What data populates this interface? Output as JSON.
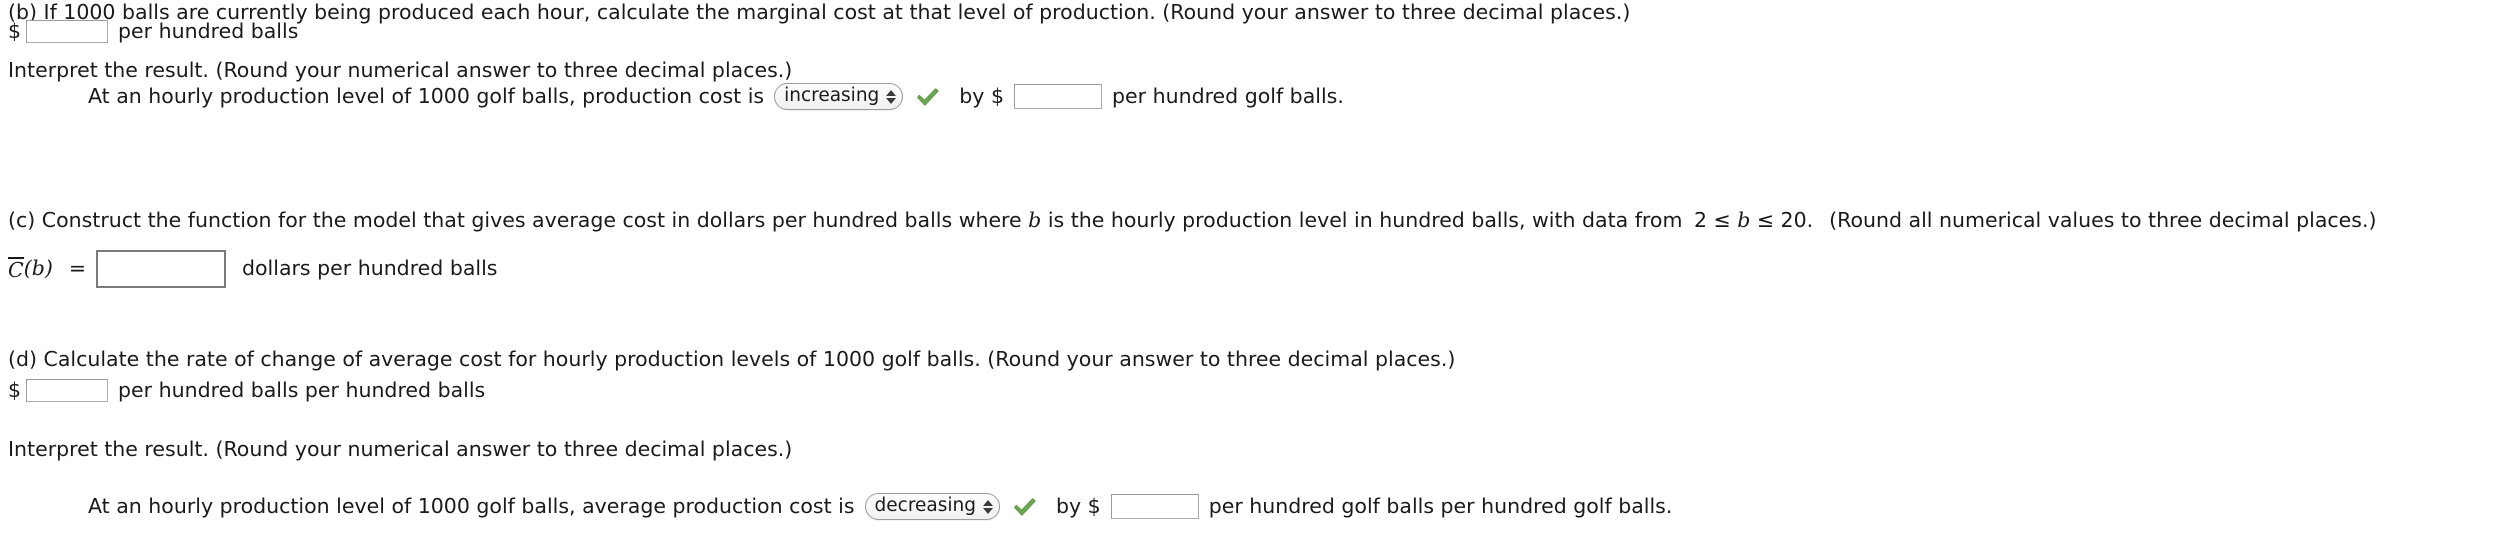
{
  "colors": {
    "text": "#1a1a1a",
    "check_green": "#6aa84f",
    "input_border": "#a9a9a9",
    "pill_border": "#9b9b9b",
    "background": "#ffffff"
  },
  "part_b": {
    "prompt": "(b) If 1000 balls are currently being produced each hour, calculate the marginal cost at that level of production. (Round your answer to three decimal places.)",
    "dollar_sign": "$",
    "answer_value": "",
    "answer_placeholder": "",
    "units": "per hundred balls",
    "interpret_prompt": "Interpret the result. (Round your numerical answer to three decimal places.)",
    "interpret_lead": "At an hourly production level of 1000 golf balls, production cost is",
    "direction_selected": "increasing",
    "direction_options": [
      "increasing",
      "decreasing"
    ],
    "check_icon": "check-icon",
    "by_label": "by $",
    "by_value": "",
    "by_units": "per hundred golf balls."
  },
  "part_c": {
    "prompt_pre": "(c) Construct the function for the model that gives average cost in dollars per hundred balls where ",
    "var_b": "b",
    "prompt_mid": " is the hourly production level in hundred balls, with data from ",
    "domain_low": "2 ≤ ",
    "domain_var": "b",
    "domain_high": " ≤ 20.",
    "prompt_post": "(Round all numerical values to three decimal places.)",
    "function_name_c": "C",
    "function_arg_open": "(",
    "function_arg": "b",
    "function_arg_close": ")",
    "equals": "=",
    "answer_value": "",
    "units": "dollars per hundred balls"
  },
  "part_d": {
    "prompt": "(d) Calculate the rate of change of average cost for hourly production levels of 1000 golf balls. (Round your answer to three decimal places.)",
    "dollar_sign": "$",
    "answer_value": "",
    "units": "per hundred balls per hundred balls",
    "interpret_prompt": "Interpret the result. (Round your numerical answer to three decimal places.)",
    "interpret_lead": "At an hourly production level of 1000 golf balls, average production cost is",
    "direction_selected": "decreasing",
    "direction_options": [
      "increasing",
      "decreasing"
    ],
    "check_icon": "check-icon",
    "by_label": "by $",
    "by_value": "",
    "by_units": "per hundred golf balls per hundred golf balls."
  }
}
